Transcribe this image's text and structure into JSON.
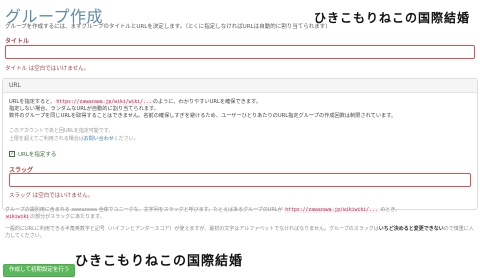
{
  "page": {
    "title": "グループ作成",
    "intro": "グループを作成するには、まずグループのタイトルとURLを決定します。（とくに指定しなければURLは自動的に割り当てられます）"
  },
  "watermark": {
    "top": "ひきこもりねこの国際結婚",
    "bottom": "ひきこもりねこの国際結婚"
  },
  "title_field": {
    "label": "タイトル",
    "value": "",
    "error": "タイトル は空白ではいけません。"
  },
  "url_panel": {
    "heading": "URL",
    "line1_a": "URLを指定すると、",
    "line1_code": "https://zawazawa.jp/wiki/wiki/...",
    "line1_b": "のように、わかりやすいURLを確保できます。",
    "line2": "指定しない場合、ランダムなURLが自動的に割り当てられます。",
    "line3": "数件のグループを同じURLを取得することはできません。名前の確保しすぎを避けるため、ユーザーひとりあたりのURL指定グループの作成回数は制限されています。",
    "muted1": "このアカウントであと回URLを指定可能です。",
    "muted2_a": "上限を超えてご利用される場合は",
    "muted2_link": "お問い合わせ",
    "muted2_b": "ください。",
    "checkbox_label": "URLを指定する",
    "checkbox_checked": true
  },
  "slug_field": {
    "label": "スラッグ",
    "value": "",
    "error": "スラッグ は空白ではいけません。"
  },
  "slug_help": {
    "desc_a": "グループの識別用に含まれる zawazawa 全体でユニークな、文字列をスラッグと呼びます。たとえばあるグループのURLが",
    "desc_code": "https://zawazawa.jp/wikiwiki/...",
    "desc_b": "のとき、",
    "desc_code2": "wikiwiki",
    "desc_c": "の部分がスラッグにあたります。",
    "note_a": "一般的にURLに利用できる半角英数字と記号（ハイフンとアンダースコア）が使えますが、最初の文字はアルファベットでなければなりません。グループのスラッグは",
    "note_bold": "いちど決めると変更できない",
    "note_b": "ので慎重に入力してください。"
  },
  "submit": {
    "label": "作成して初期設定を行う"
  },
  "colors": {
    "title": "#5f8ba5",
    "error": "#a94442",
    "success": "#5cb85c"
  }
}
